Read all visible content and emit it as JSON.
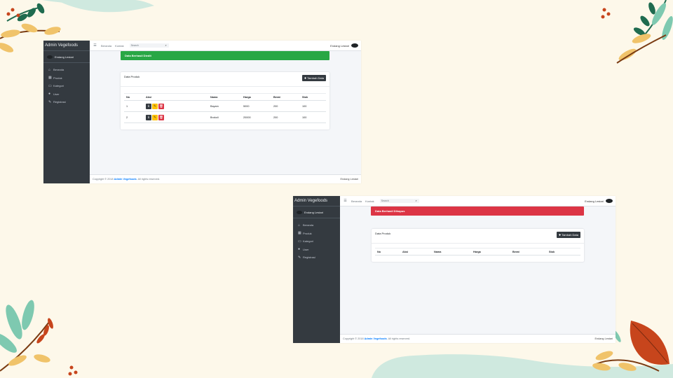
{
  "screenshots": [
    {
      "brand": "Admin Vegefoods",
      "user_name": "Endang Lestari",
      "nav": [
        {
          "icon": "home-icon",
          "glyph": "⌂",
          "label": "Beranda"
        },
        {
          "icon": "calendar-icon",
          "glyph": "▦",
          "label": "Produk"
        },
        {
          "icon": "card-icon",
          "glyph": "▭",
          "label": "Kategori"
        },
        {
          "icon": "user-icon",
          "glyph": "●",
          "label": "User"
        },
        {
          "icon": "edit-icon",
          "glyph": "✎",
          "label": "Registrasi"
        }
      ],
      "topbar": {
        "link_home": "Beranda",
        "link_contact": "Kontak",
        "search_placeholder": "Search",
        "user": "Endang Lestari"
      },
      "alert": {
        "text": "Data Berhasil Diedit",
        "color": "#28a745"
      },
      "card": {
        "title": "Data Produk",
        "add_label": "Tambah Data"
      },
      "table": {
        "headers": [
          "No",
          "Aksi",
          "Nama",
          "Harga",
          "Berat",
          "Stok"
        ],
        "rows": [
          {
            "no": "1",
            "nama": "Bayam",
            "harga": "5000",
            "berat": "200",
            "stok": "100"
          },
          {
            "no": "2",
            "nama": "Brokoli",
            "harga": "20000",
            "berat": "200",
            "stok": "100"
          }
        ]
      },
      "footer": {
        "prefix": "Copyright © 2018",
        "brand": "Admin Vegefoods",
        "suffix": "All rights reserved.",
        "right": "Endang Lestari"
      }
    },
    {
      "brand": "Admin Vegefoods",
      "user_name": "Endang Lestari",
      "nav": [
        {
          "icon": "home-icon",
          "glyph": "⌂",
          "label": "Beranda"
        },
        {
          "icon": "calendar-icon",
          "glyph": "▦",
          "label": "Produk"
        },
        {
          "icon": "card-icon",
          "glyph": "▭",
          "label": "Kategori"
        },
        {
          "icon": "user-icon",
          "glyph": "●",
          "label": "User"
        },
        {
          "icon": "edit-icon",
          "glyph": "✎",
          "label": "Registrasi"
        }
      ],
      "topbar": {
        "link_home": "Beranda",
        "link_contact": "Kontak",
        "search_placeholder": "Search",
        "user": "Endang Lestari"
      },
      "alert": {
        "text": "Data Berhasil Dihapus",
        "color": "#dc3545"
      },
      "card": {
        "title": "Data Produk",
        "add_label": "Tambah Data"
      },
      "table": {
        "headers": [
          "No",
          "Aksi",
          "Nama",
          "Harga",
          "Berat",
          "Stok"
        ],
        "rows": []
      },
      "footer": {
        "prefix": "Copyright © 2018",
        "brand": "Admin Vegefoods",
        "suffix": "All rights reserved.",
        "right": "Endang Lestari"
      }
    }
  ],
  "colors": {
    "background": "#fdf8ea",
    "sidebar": "#343a40",
    "success": "#28a745",
    "danger": "#dc3545",
    "warning": "#ffc107",
    "link": "#007bff",
    "leaf_green": "#1f6b4f",
    "leaf_orange": "#c7451c",
    "leaf_mint": "#7ec9b0",
    "leaf_yellow": "#f0c36a"
  }
}
